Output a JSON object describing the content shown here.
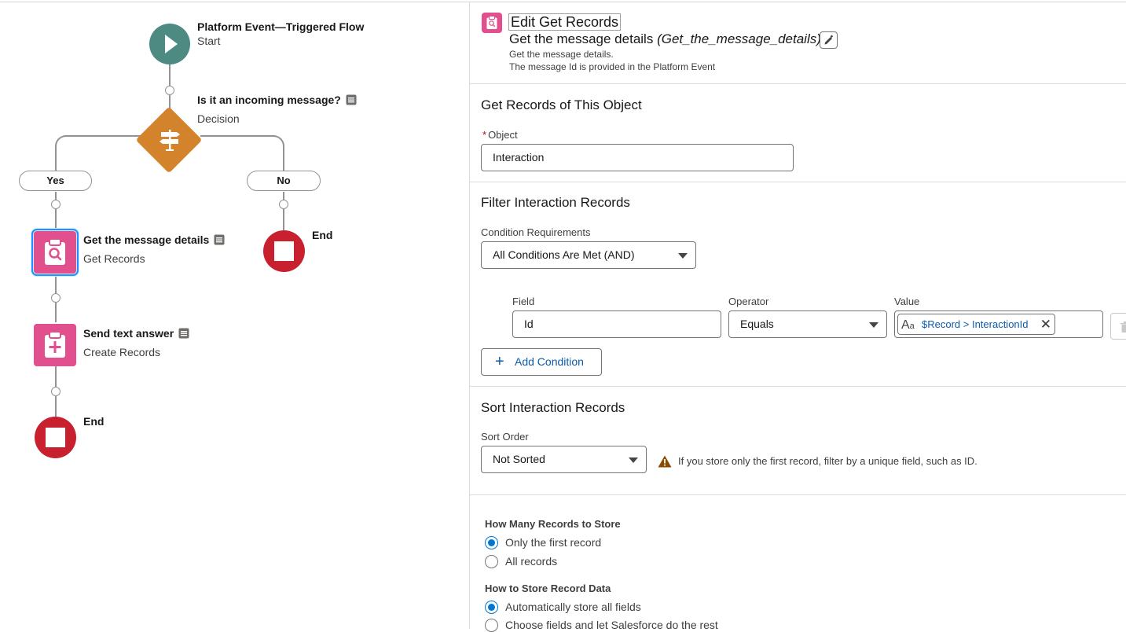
{
  "flow": {
    "start": {
      "title": "Platform Event—Triggered Flow",
      "subtitle": "Start"
    },
    "decision": {
      "title": "Is it an incoming message?",
      "subtitle": "Decision"
    },
    "branches": {
      "yes": "Yes",
      "no": "No"
    },
    "get_records": {
      "title": "Get the message details",
      "subtitle": "Get Records"
    },
    "create_records": {
      "title": "Send text answer",
      "subtitle": "Create Records"
    },
    "end_no": "End",
    "end_main": "End"
  },
  "panel": {
    "title": "Edit Get Records",
    "element_label": "Get the message details",
    "element_api_name": "(Get_the_message_details)",
    "description_line1": "Get the message details.",
    "description_line2": "The message Id is provided in the Platform Event",
    "object_section": {
      "title": "Get Records of This Object",
      "required_mark": "*",
      "object_label": "Object",
      "object_value": "Interaction"
    },
    "filter_section": {
      "title": "Filter Interaction Records",
      "requirements_label": "Condition Requirements",
      "requirements_value": "All Conditions Are Met (AND)",
      "field_header": "Field",
      "operator_header": "Operator",
      "value_header": "Value",
      "condition": {
        "field": "Id",
        "operator": "Equals",
        "value_type_glyph": "A",
        "value_type_glyph_small": "a",
        "value": "$Record > InteractionId"
      },
      "add_condition": "Add Condition"
    },
    "sort_section": {
      "title": "Sort Interaction Records",
      "sort_label": "Sort Order",
      "sort_value": "Not Sorted",
      "warning": "If you store only the first record, filter by a unique field, such as ID."
    },
    "store_section": {
      "how_many_label": "How Many Records to Store",
      "opt_first": "Only the first record",
      "opt_all": "All records",
      "how_to_label": "How to Store Record Data",
      "opt_auto": "Automatically store all fields",
      "opt_choose": "Choose fields and let Salesforce do the rest"
    }
  },
  "colors": {
    "start": "#4c8a82",
    "decision": "#d3832b",
    "record_element": "#e14f8f",
    "end": "#c8202f",
    "link": "#0b5cab",
    "radio_selected": "#0176d3"
  },
  "icons": [
    "play-icon",
    "signpost-icon",
    "clipboard-search-icon",
    "clipboard-add-icon",
    "stop-icon",
    "note-icon",
    "pencil-icon",
    "plus-icon",
    "warning-icon",
    "trash-icon",
    "close-icon",
    "caret-down-icon",
    "text-type-icon"
  ]
}
